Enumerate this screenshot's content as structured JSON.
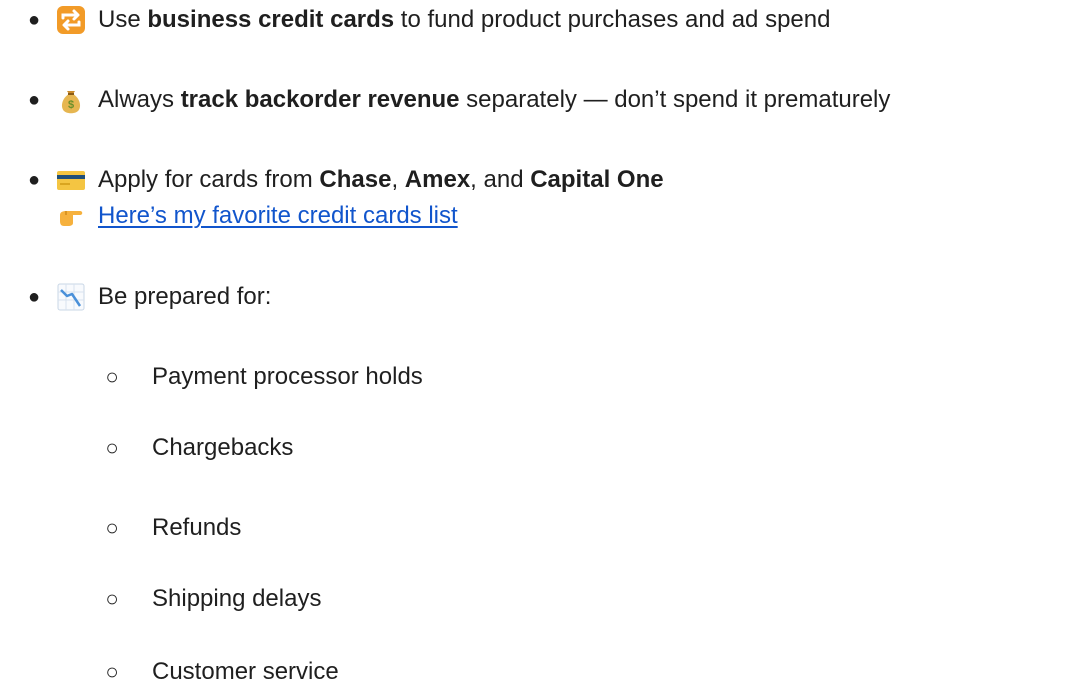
{
  "bullets": [
    {
      "icon": "repeat-arrows-icon",
      "parts": [
        "Use ",
        "business credit cards",
        " to fund product purchases and ad spend"
      ]
    },
    {
      "icon": "money-bag-icon",
      "parts": [
        "Always ",
        "track backorder revenue",
        " separately — don’t spend it prematurely"
      ]
    },
    {
      "icon": "credit-card-icon",
      "parts": [
        "Apply for cards from ",
        "Chase",
        ", ",
        "Amex",
        ", and ",
        "Capital One"
      ],
      "link_icon": "pointing-hand-icon",
      "link_text": "Here’s my favorite credit cards list"
    },
    {
      "icon": "chart-decreasing-icon",
      "parts": [
        "Be prepared for:"
      ],
      "sub_items": [
        "Payment processor holds",
        "Chargebacks",
        "Refunds",
        "Shipping delays",
        "Customer service"
      ]
    }
  ],
  "colors": {
    "text": "#1f1f1f",
    "link": "#1155cc"
  }
}
